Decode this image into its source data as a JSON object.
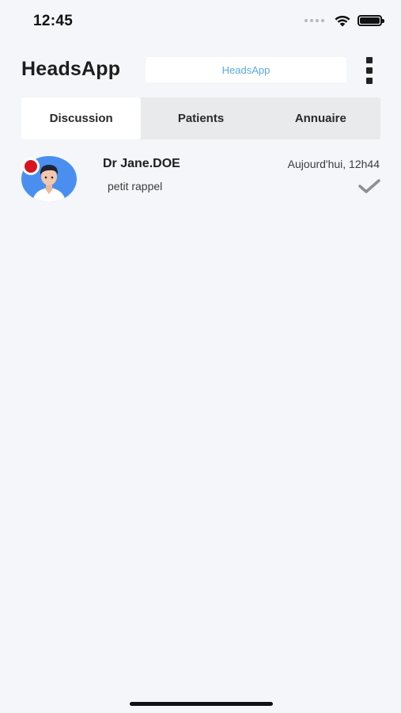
{
  "status_bar": {
    "time": "12:45",
    "icons": [
      "signal-dots-icon",
      "wifi-icon",
      "battery-icon"
    ]
  },
  "header": {
    "title": "HeadsApp",
    "box_label": "HeadsApp",
    "menu_icon": "more-vertical-icon"
  },
  "tabs": [
    {
      "label": "Discussion",
      "active": true
    },
    {
      "label": "Patients",
      "active": false
    },
    {
      "label": "Annuaire",
      "active": false
    }
  ],
  "conversations": [
    {
      "name": "Dr Jane.DOE",
      "time": "Aujourd'hui, 12h44",
      "preview": "petit rappel",
      "unread": true,
      "status_icon": "check-icon"
    }
  ],
  "colors": {
    "background": "#f4f6f9",
    "accent_link": "#59a9e6",
    "avatar_bg": "#4a8ff0",
    "unread_dot": "#d8141e"
  }
}
